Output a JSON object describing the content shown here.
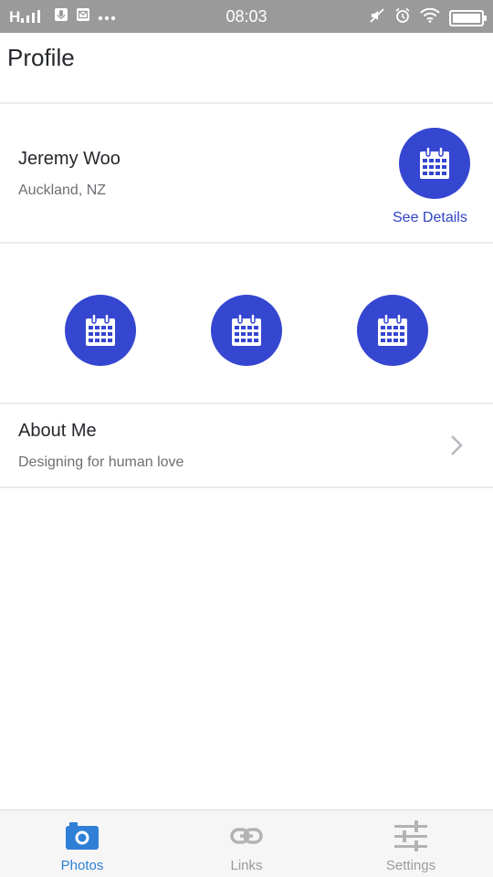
{
  "status_bar": {
    "signal": "H",
    "time": "08:03"
  },
  "header": {
    "title": "Profile"
  },
  "profile": {
    "name": "Jeremy Woo",
    "location": "Auckland, NZ",
    "details_link": "See Details",
    "action_icon": "calendar-icon"
  },
  "quick_actions": [
    {
      "icon": "calendar-icon"
    },
    {
      "icon": "calendar-icon"
    },
    {
      "icon": "calendar-icon"
    }
  ],
  "about": {
    "title": "About Me",
    "subtitle": "Designing for human love"
  },
  "bottom_nav": {
    "items": [
      {
        "label": "Photos",
        "icon": "camera-icon",
        "active": true
      },
      {
        "label": "Links",
        "icon": "link-icon",
        "active": false
      },
      {
        "label": "Settings",
        "icon": "sliders-icon",
        "active": false
      }
    ]
  },
  "colors": {
    "accent": "#3546d0",
    "link": "#2f44c4",
    "nav_active": "#2f7fd6",
    "nav_inactive": "#9b9b9b",
    "status_bar": "#9a9a9a"
  }
}
